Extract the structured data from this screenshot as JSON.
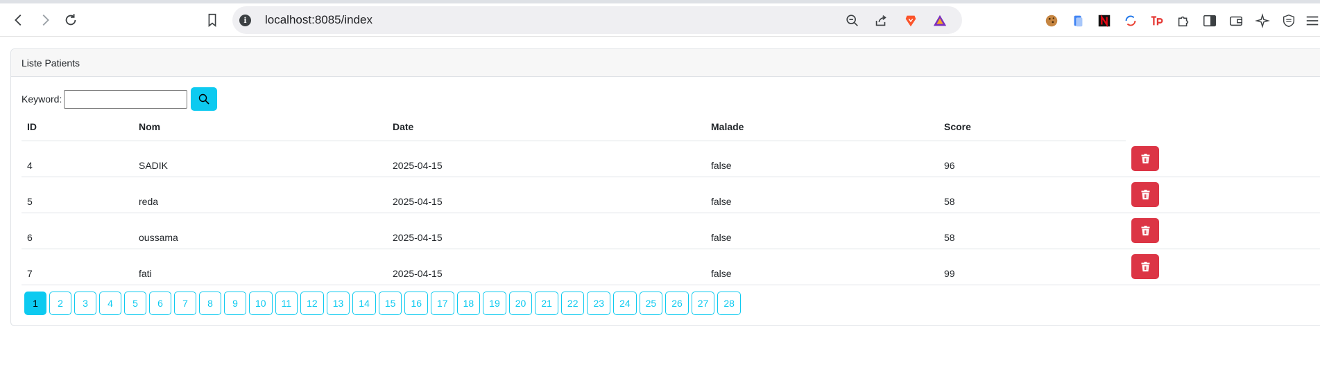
{
  "browser": {
    "url": "localhost:8085/index"
  },
  "page": {
    "card_title": "Liste Patients",
    "search": {
      "label": "Keyword:",
      "value": "",
      "placeholder": ""
    },
    "table": {
      "headers": [
        "ID",
        "Nom",
        "Date",
        "Malade",
        "Score"
      ],
      "rows": [
        {
          "id": "4",
          "nom": "SADIK",
          "date": "2025-04-15",
          "malade": "false",
          "score": "96"
        },
        {
          "id": "5",
          "nom": "reda",
          "date": "2025-04-15",
          "malade": "false",
          "score": "58"
        },
        {
          "id": "6",
          "nom": "oussama",
          "date": "2025-04-15",
          "malade": "false",
          "score": "58"
        },
        {
          "id": "7",
          "nom": "fati",
          "date": "2025-04-15",
          "malade": "false",
          "score": "99"
        }
      ]
    },
    "pagination": {
      "current": "1",
      "pages": [
        "1",
        "2",
        "3",
        "4",
        "5",
        "6",
        "7",
        "8",
        "9",
        "10",
        "11",
        "12",
        "13",
        "14",
        "15",
        "16",
        "17",
        "18",
        "19",
        "20",
        "21",
        "22",
        "23",
        "24",
        "25",
        "26",
        "27",
        "28"
      ]
    }
  },
  "colors": {
    "info": "#0dcaf0",
    "danger": "#dc3545"
  },
  "icons": {
    "search": "search-icon",
    "delete": "trash-icon"
  }
}
